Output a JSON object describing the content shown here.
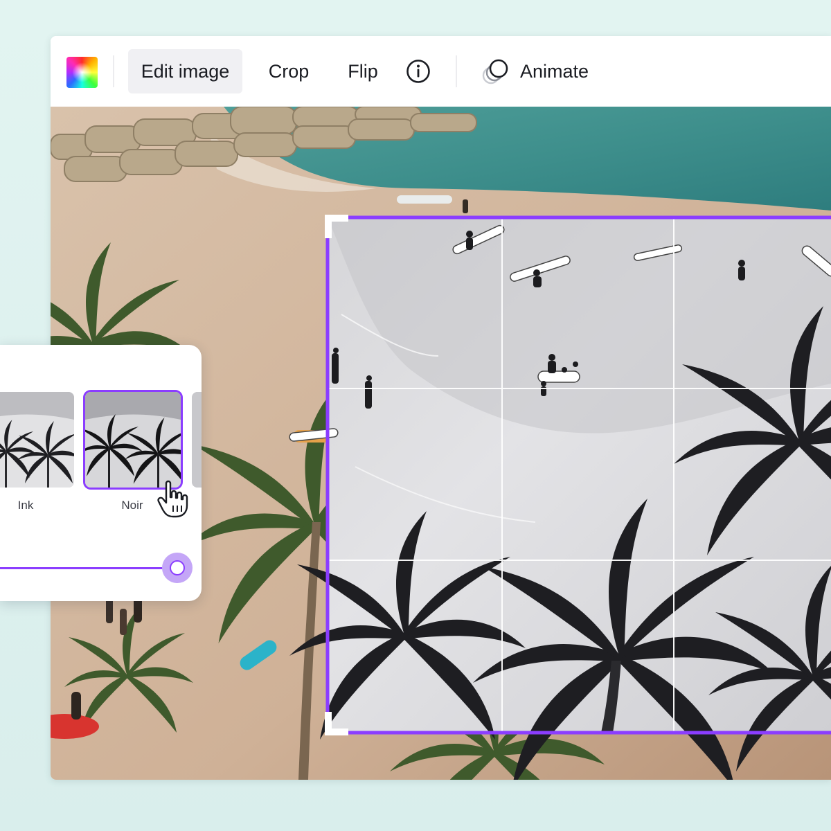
{
  "toolbar": {
    "color_icon": "color-wheel-icon",
    "edit_image_label": "Edit image",
    "crop_label": "Crop",
    "flip_label": "Flip",
    "info_icon": "info-icon",
    "animate_icon": "animate-icon",
    "animate_label": "Animate"
  },
  "filters": {
    "items": [
      {
        "label": "Ink",
        "selected": false
      },
      {
        "label": "Noir",
        "selected": true
      }
    ],
    "intensity": 1.0
  },
  "colors": {
    "accent": "#8b3dff",
    "accent_soft": "#c4a6f7",
    "toolbar_active_bg": "#f0f0f3"
  }
}
